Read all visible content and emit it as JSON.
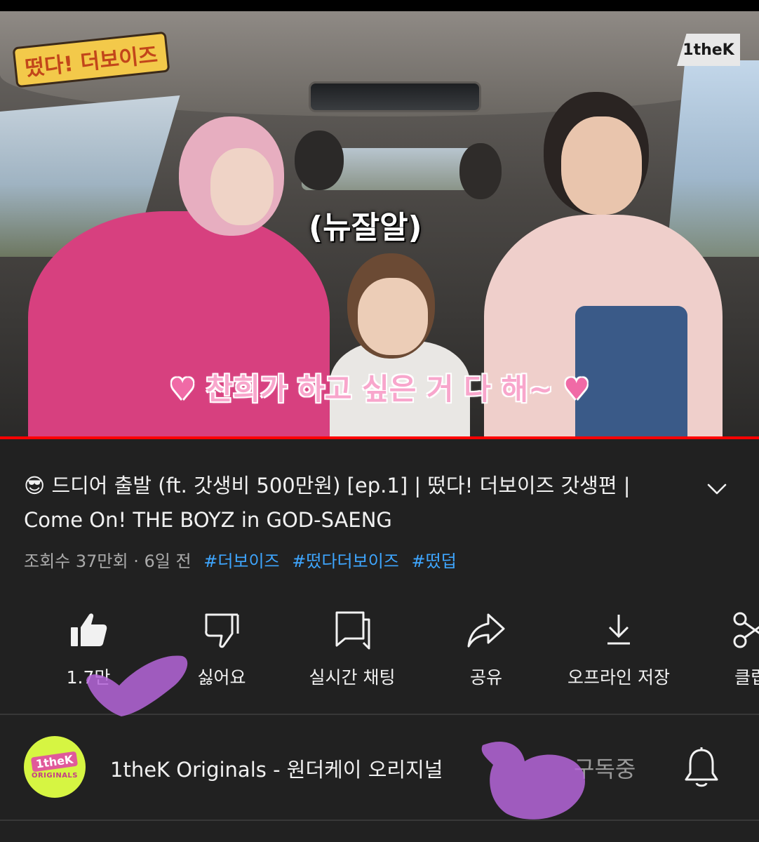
{
  "video": {
    "show_logo": "떴다! 더보이즈",
    "brand_logo": "1theK",
    "subtitle_top": "(뉴잘알)",
    "subtitle_bottom": "찬희가 하고 싶은 거 다 해~",
    "progress_fraction": 1.0
  },
  "info": {
    "title": "😎 드디어 출발 (ft. 갓생비 500만원) [ep.1] | 떴다! 더보이즈 갓생편 | Come On! THE BOYZ in GOD-SAENG",
    "views": "조회수 37만회",
    "separator": "·",
    "age": "6일 전",
    "hashtags": [
      "#더보이즈",
      "#떴다더보이즈",
      "#떴덥"
    ]
  },
  "actions": [
    {
      "icon": "thumbs-up-filled-icon",
      "label": "1.7만"
    },
    {
      "icon": "thumbs-down-icon",
      "label": "싫어요"
    },
    {
      "icon": "live-chat-icon",
      "label": "실시간 채팅"
    },
    {
      "icon": "share-icon",
      "label": "공유"
    },
    {
      "icon": "download-icon",
      "label": "오프라인 저장"
    },
    {
      "icon": "clip-scissors-icon",
      "label": "클립"
    }
  ],
  "channel": {
    "avatar_text_top": "1theK",
    "avatar_text_bottom": "ORIGINALS",
    "name": "1theK Originals - 원더케이 오리지널",
    "subscribe_state": "구독중",
    "bell_icon": "bell-icon"
  },
  "colors": {
    "background": "#212121",
    "hashtag": "#3ea6ff",
    "progress": "#ff0000",
    "scribble": "#b565d9"
  }
}
